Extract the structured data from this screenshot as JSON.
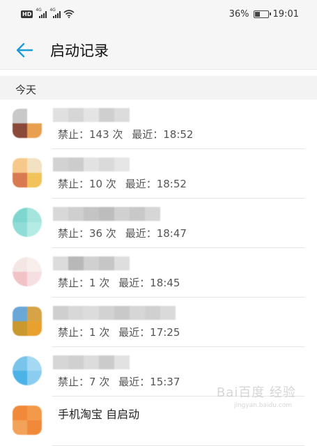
{
  "status_bar": {
    "hd_badge": "HD",
    "signal_1_label": "4G",
    "signal_2_label": "4G",
    "battery_percent": "36%",
    "time": "19:01"
  },
  "header": {
    "title": "启动记录"
  },
  "section": {
    "label": "今天"
  },
  "rows": [
    {
      "name": "",
      "blocked_label": "禁止：",
      "count": "143",
      "count_unit": "次",
      "recent_label": "最近：",
      "recent_time": "18:52",
      "icon_colors": [
        "#c9c9c9",
        "#ffffff",
        "#8a4a3a",
        "#e8a050"
      ],
      "mosaic": [
        "#e0e0e0",
        "#d6d6d6",
        "#e4e4e4",
        "#cfcfcf",
        "#dcdcdc"
      ]
    },
    {
      "name": "",
      "blocked_label": "禁止：",
      "count": "10",
      "count_unit": "次",
      "recent_label": "最近：",
      "recent_time": "18:52",
      "icon_colors": [
        "#f6c98a",
        "#f3e2c2",
        "#d9794f",
        "#f2c35a"
      ],
      "mosaic": [
        "#d2d2d2",
        "#cccccc",
        "#e2e2e2",
        "#dadada",
        "#e6e6e6"
      ]
    },
    {
      "name": "",
      "blocked_label": "禁止：",
      "count": "36",
      "count_unit": "次",
      "recent_label": "最近：",
      "recent_time": "18:47",
      "icon_colors": [
        "#7ed6cf",
        "#a6e4de",
        "#8fddd6",
        "#b5ebe5"
      ],
      "mosaic": [
        "#d8d8d8",
        "#cfcfcf",
        "#c4c4c4",
        "#bdbdbd",
        "#d0d0d0",
        "#c8c8c8",
        "#d6d6d6"
      ]
    },
    {
      "name": "",
      "blocked_label": "禁止：",
      "count": "1",
      "count_unit": "次",
      "recent_label": "最近：",
      "recent_time": "18:45",
      "icon_colors": [
        "#f4e6e4",
        "#f8efec",
        "#f1c3c6",
        "#f6dfe0"
      ],
      "mosaic": [
        "#dcdcdc",
        "#b8b8b8",
        "#d0d0d0",
        "#c6c6c6",
        "#dedede"
      ]
    },
    {
      "name": "",
      "blocked_label": "禁止：",
      "count": "1",
      "count_unit": "次",
      "recent_label": "最近：",
      "recent_time": "17:25",
      "icon_colors": [
        "#6aa8d8",
        "#d6a447",
        "#c9982e",
        "#e8a12e"
      ],
      "mosaic": [
        "#cfcfcf",
        "#d8d8d8",
        "#dcdcdc",
        "#d2d2d2",
        "#c9c9c9",
        "#d6d6d6",
        "#d0d0d0",
        "#dadada"
      ]
    },
    {
      "name": "",
      "blocked_label": "禁止：",
      "count": "7",
      "count_unit": "次",
      "recent_label": "最近：",
      "recent_time": "15:37",
      "icon_colors": [
        "#79c4ea",
        "#a5d8f2",
        "#4bb3e6",
        "#8acdf0"
      ],
      "mosaic": [
        "#d6d6d6",
        "#d0d0d0",
        "#dcdcdc",
        "#cbcbcb",
        "#e2e2e2"
      ]
    },
    {
      "name": "手机淘宝 自启动",
      "blocked_label": "",
      "count": "",
      "count_unit": "",
      "recent_label": "",
      "recent_time": "",
      "icon_colors": [
        "#f08a3a",
        "#f39a4a",
        "#f3a25a",
        "#f0893a"
      ],
      "mosaic": []
    }
  ],
  "colors": {
    "accent": "#1a9ad6",
    "background": "#ffffff",
    "statusbar": "#f6f6f6",
    "section_bg": "#f3f3f3"
  },
  "icons": {
    "back": "back-arrow-icon",
    "wifi": "wifi-icon",
    "battery": "battery-icon",
    "signal": "signal-icon"
  },
  "watermark": {
    "text": "Bai百度 经验",
    "sub": "jingyan.baidu.com"
  }
}
